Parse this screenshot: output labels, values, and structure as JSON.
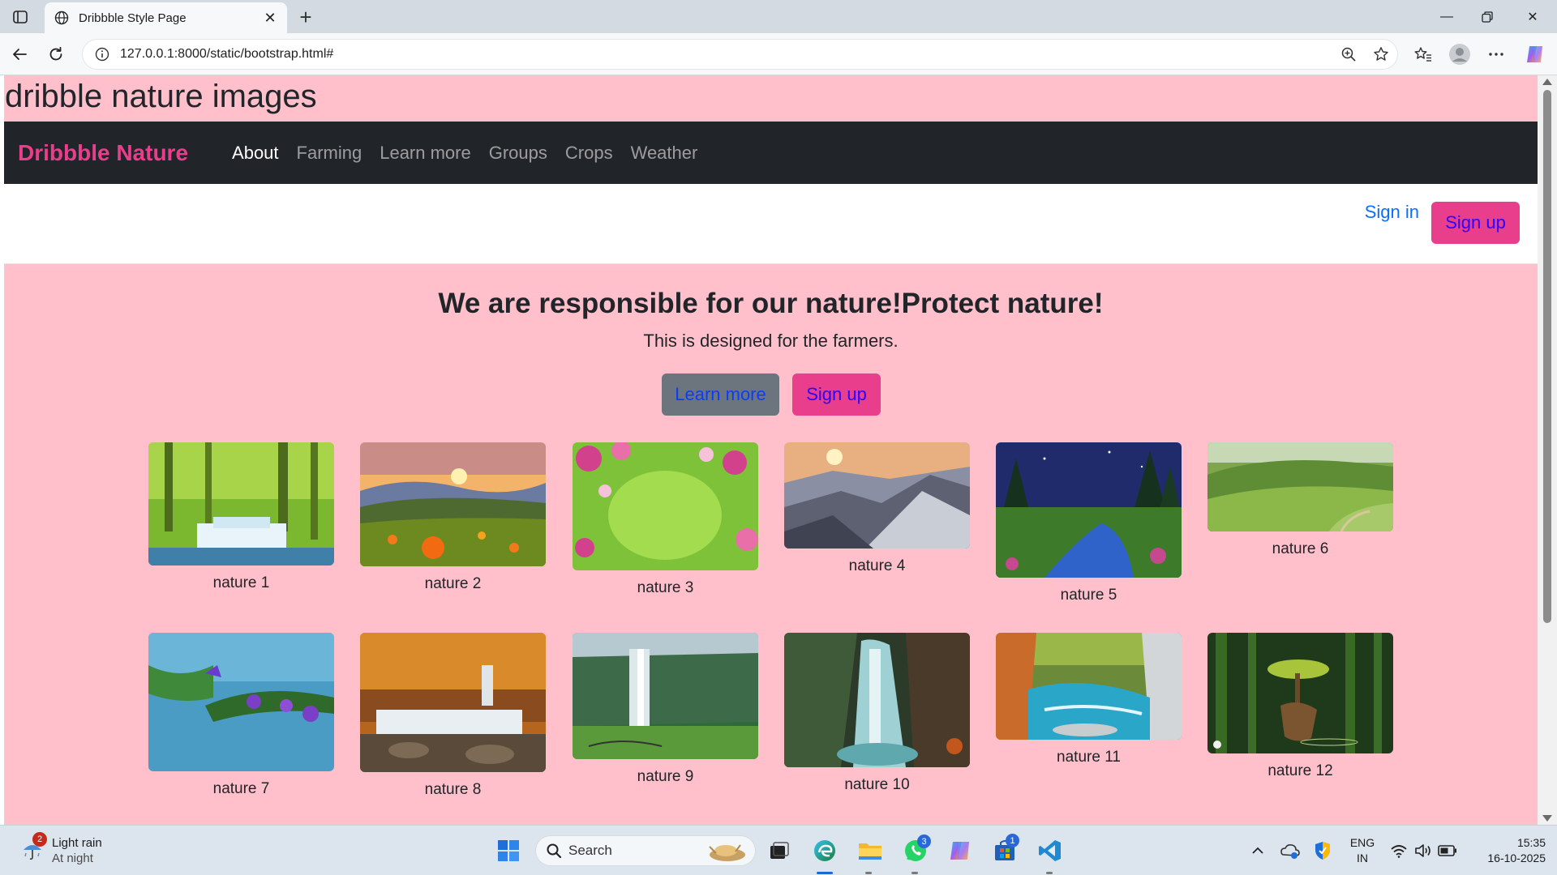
{
  "browser": {
    "tab_title": "Dribbble Style Page",
    "url": "127.0.0.1:8000/static/bootstrap.html#"
  },
  "page": {
    "heading": "dribble nature images",
    "brand": "Dribbble Nature",
    "nav": [
      "About",
      "Farming",
      "Learn more",
      "Groups",
      "Crops",
      "Weather"
    ],
    "sign_in": "Sign in",
    "sign_up": "Sign up",
    "hero_title": "We are responsible for our nature!Protect nature!",
    "hero_subtitle": "This is designed for the farmers.",
    "hero_learn_more": "Learn more",
    "hero_sign_up": "Sign up",
    "gallery": [
      {
        "caption": "nature 1"
      },
      {
        "caption": "nature 2"
      },
      {
        "caption": "nature 3"
      },
      {
        "caption": "nature 4"
      },
      {
        "caption": "nature 5"
      },
      {
        "caption": "nature 6"
      },
      {
        "caption": "nature 7"
      },
      {
        "caption": "nature 8"
      },
      {
        "caption": "nature 9"
      },
      {
        "caption": "nature 10"
      },
      {
        "caption": "nature 11"
      },
      {
        "caption": "nature 12"
      }
    ]
  },
  "taskbar": {
    "weather_line1": "Light rain",
    "weather_line2": "At night",
    "weather_badge": "2",
    "search_label": "Search",
    "whatsapp_badge": "3",
    "store_badge": "1",
    "lang_line1": "ENG",
    "lang_line2": "IN",
    "time": "15:35",
    "date": "16-10-2025"
  },
  "colors": {
    "page_bg": "#ffc0cb",
    "navbar_bg": "#212529",
    "brand_pink": "#e83e8c",
    "link_blue": "#0d6efd",
    "secondary_btn": "#6c757d"
  }
}
